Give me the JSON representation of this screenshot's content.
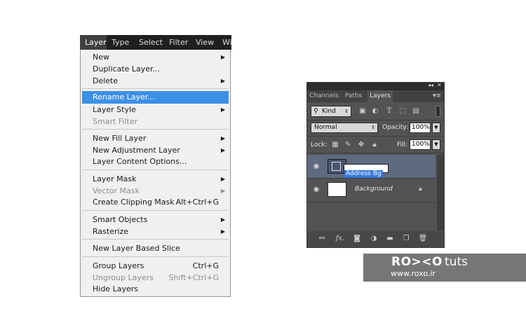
{
  "menubar": {
    "items": [
      {
        "label": "Layer",
        "active": true
      },
      {
        "label": "Type"
      },
      {
        "label": "Select"
      },
      {
        "label": "Filter"
      },
      {
        "label": "View"
      },
      {
        "label": "Wi"
      }
    ]
  },
  "layer_menu": {
    "new": "New",
    "duplicate_layer": "Duplicate Layer...",
    "delete": "Delete",
    "rename_layer": "Rename Layer...",
    "layer_style": "Layer Style",
    "smart_filter": "Smart Filter",
    "new_fill_layer": "New Fill Layer",
    "new_adjustment_layer": "New Adjustment Layer",
    "layer_content_options": "Layer Content Options...",
    "layer_mask": "Layer Mask",
    "vector_mask": "Vector Mask",
    "create_clipping_mask": "Create Clipping Mask",
    "create_clipping_mask_shortcut": "Alt+Ctrl+G",
    "smart_objects": "Smart Objects",
    "rasterize": "Rasterize",
    "new_layer_based_slice": "New Layer Based Slice",
    "group_layers": "Group Layers",
    "group_layers_shortcut": "Ctrl+G",
    "ungroup_layers": "Ungroup Layers",
    "ungroup_layers_shortcut": "Shift+Ctrl+G",
    "hide_layers": "Hide Layers",
    "highlight_color": "#3c90e5"
  },
  "layers_panel": {
    "collapse_glyph": "◂◂",
    "close_glyph": "✕",
    "tabs": [
      {
        "label": "Channels"
      },
      {
        "label": "Paths"
      },
      {
        "label": "Layers",
        "active": true
      }
    ],
    "filter_kind": "Kind",
    "blend_mode": "Normal",
    "opacity_label": "Opacity:",
    "opacity_value": "100%",
    "lock_label": "Lock:",
    "fill_label": "Fill:",
    "fill_value": "100%",
    "layers": [
      {
        "name": "Address Bg",
        "selected": true,
        "editing": true,
        "icon": "smart-object-thumbnail"
      },
      {
        "name": "Background",
        "italic": true,
        "locked": true,
        "icon": "white-thumbnail"
      }
    ],
    "bottom_icons": [
      "link-icon",
      "fx-icon",
      "mask-icon",
      "adjustment-icon",
      "group-folder-icon",
      "new-layer-icon",
      "trash-icon"
    ],
    "fx_label": "fx.",
    "selected_row_color": "#5e6a80"
  },
  "watermark": {
    "logo": "RO><O",
    "tuts": "tuts",
    "url": "www.roxo.ir"
  }
}
